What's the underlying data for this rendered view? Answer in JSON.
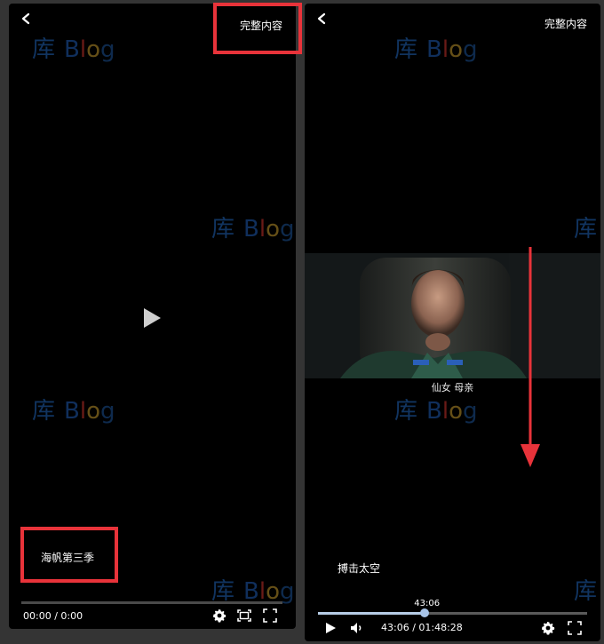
{
  "left_player": {
    "full_content_link": "完整内容",
    "series_title": "海帆第三季",
    "time_display": "00:00 / 0:00",
    "progress": 0,
    "icons": {
      "back": "chevron-left-icon",
      "play": "play-icon",
      "settings": "gear-icon",
      "screen_mode": "theater-mode-icon",
      "fullscreen": "fullscreen-icon"
    }
  },
  "right_player": {
    "full_content_link": "完整内容",
    "series_title": "搏击太空",
    "subtitle": "仙女  母亲",
    "hover_time": "43:06",
    "time_display": "43:06 / 01:48:28",
    "progress": 0.397,
    "icons": {
      "back": "chevron-left-icon",
      "play": "play-icon",
      "volume": "volume-icon",
      "settings": "gear-icon",
      "fullscreen": "fullscreen-icon"
    }
  },
  "colors": {
    "page_background": "#343434",
    "player_background": "#000000",
    "annotation_red": "#e8333a",
    "progress_fill": "#b7cde6"
  }
}
